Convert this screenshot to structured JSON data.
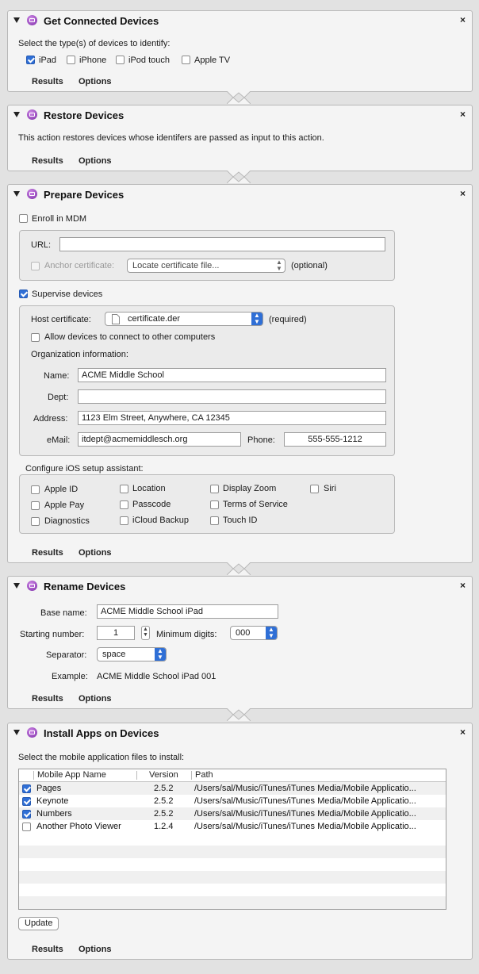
{
  "common": {
    "results": "Results",
    "options": "Options",
    "close": "×"
  },
  "get_devices": {
    "title": "Get Connected Devices",
    "prompt": "Select the type(s) of devices to identify:",
    "types": [
      {
        "label": "iPad",
        "checked": true
      },
      {
        "label": "iPhone",
        "checked": false
      },
      {
        "label": "iPod touch",
        "checked": false
      },
      {
        "label": "Apple TV",
        "checked": false
      }
    ]
  },
  "restore": {
    "title": "Restore Devices",
    "desc": "This action restores devices whose identifers are passed as input to this action."
  },
  "prepare": {
    "title": "Prepare Devices",
    "enroll_mdm": "Enroll in MDM",
    "url_label": "URL:",
    "url_value": "",
    "anchor_label": "Anchor certificate:",
    "anchor_popup": "Locate certificate file...",
    "optional": "(optional)",
    "supervise": "Supervise devices",
    "host_cert_label": "Host certificate:",
    "host_cert_value": "certificate.der",
    "required": "(required)",
    "allow_connect": "Allow devices to connect to other computers",
    "org_info": "Organization information:",
    "name_label": "Name:",
    "name_value": "ACME Middle School",
    "dept_label": "Dept:",
    "dept_value": "",
    "address_label": "Address:",
    "address_value": "1123 Elm Street, Anywhere, CA 12345",
    "email_label": "eMail:",
    "email_value": "itdept@acmemiddlesch.org",
    "phone_label": "Phone:",
    "phone_value": "555-555-1212",
    "setup_label": "Configure iOS setup assistant:",
    "setup": [
      "Apple ID",
      "Location",
      "Display Zoom",
      "Siri",
      "Apple Pay",
      "Passcode",
      "Terms of Service",
      "Diagnostics",
      "iCloud Backup",
      "Touch ID"
    ]
  },
  "rename": {
    "title": "Rename Devices",
    "base_label": "Base name:",
    "base_value": "ACME Middle School iPad",
    "start_label": "Starting number:",
    "start_value": "1",
    "min_digits_label": "Minimum digits:",
    "min_digits_value": "000",
    "sep_label": "Separator:",
    "sep_value": "space",
    "example_label": "Example:",
    "example_value": "ACME Middle School iPad 001"
  },
  "install": {
    "title": "Install Apps on Devices",
    "prompt": "Select the mobile application files to install:",
    "columns": [
      "Mobile App Name",
      "Version",
      "Path"
    ],
    "rows": [
      {
        "name": "Pages",
        "version": "2.5.2",
        "path": "/Users/sal/Music/iTunes/iTunes Media/Mobile Applicatio...",
        "checked": true
      },
      {
        "name": "Keynote",
        "version": "2.5.2",
        "path": "/Users/sal/Music/iTunes/iTunes Media/Mobile Applicatio...",
        "checked": true
      },
      {
        "name": "Numbers",
        "version": "2.5.2",
        "path": "/Users/sal/Music/iTunes/iTunes Media/Mobile Applicatio...",
        "checked": true
      },
      {
        "name": "Another Photo Viewer",
        "version": "1.2.4",
        "path": "/Users/sal/Music/iTunes/iTunes Media/Mobile Applicatio...",
        "checked": false
      }
    ],
    "update": "Update"
  }
}
